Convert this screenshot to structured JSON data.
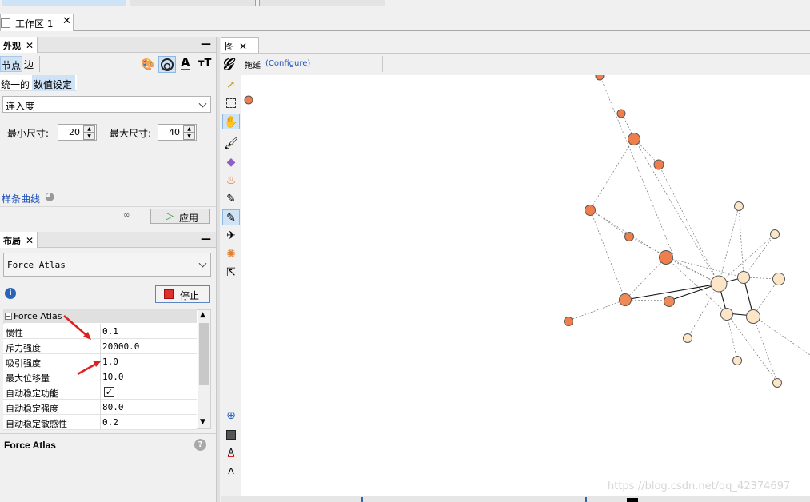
{
  "workspace": {
    "tab_label": "工作区 1"
  },
  "appearance": {
    "title": "外观",
    "tabs": [
      "节点",
      "边"
    ],
    "subtabs": [
      "统一的",
      "数值设定"
    ],
    "attribute": "连入度",
    "min_size_label": "最小尺寸:",
    "min_size": "20",
    "max_size_label": "最大尺寸:",
    "max_size": "40",
    "spline_label": "样条曲线",
    "apply_label": "应用",
    "text_icon": "A",
    "size_icon": "тT"
  },
  "layout": {
    "title": "布局",
    "algorithm": "Force Atlas",
    "stop_label": "停止",
    "group_label": "Force Atlas",
    "properties": [
      {
        "name": "惯性",
        "value": "0.1"
      },
      {
        "name": "斥力强度",
        "value": "20000.0"
      },
      {
        "name": "吸引强度",
        "value": "1.0"
      },
      {
        "name": "最大位移量",
        "value": "10.0"
      },
      {
        "name": "自动稳定功能",
        "value": ""
      },
      {
        "name": "自动稳定强度",
        "value": "80.0"
      },
      {
        "name": "自动稳定敏感性",
        "value": "0.2"
      }
    ],
    "description_title": "Force Atlas"
  },
  "graph": {
    "title": "图",
    "drag_label": "拖延",
    "configure_label": "(Configure)"
  },
  "toolbar_text": {
    "text_a": "A",
    "text_a2": "A"
  },
  "watermark": "https://blog.csdn.net/qq_42374697",
  "colors": {
    "accent": "#2255bb",
    "node_dark": "#ee7f4c",
    "node_light": "#fde6c8"
  }
}
